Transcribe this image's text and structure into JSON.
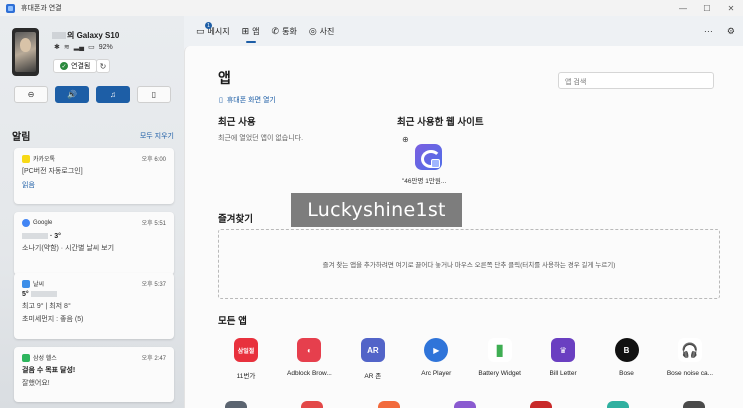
{
  "window": {
    "title": "휴대폰과 연결",
    "controls": [
      "—",
      "☐",
      "✕"
    ]
  },
  "device": {
    "name": "의 Galaxy S10",
    "battery": "92%",
    "connected_label": "연결됨"
  },
  "quick_actions": [
    {
      "icon": "⊖",
      "on": false
    },
    {
      "icon": "🔊",
      "on": true
    },
    {
      "icon": "♫",
      "on": true
    },
    {
      "icon": "▯",
      "on": false
    }
  ],
  "notifications": {
    "title": "알림",
    "clear_all": "모두 지우기",
    "cards": [
      {
        "app": "카카오톡",
        "time": "오후 6:00",
        "lines": [
          "[PC버전 자동로그인]"
        ],
        "link": "읽음",
        "color": "#f7d916"
      },
      {
        "app": "Google",
        "time": "오후 5:51",
        "lines": [
          "· 3°",
          "소나기(약함) · 시간별 날씨 보기"
        ],
        "color": "#4285f4"
      },
      {
        "app": "날씨",
        "time": "오후 5:37",
        "lines": [
          "5°",
          "최고 9° | 최저 8°",
          "초미세먼지 : 좋음 (5)"
        ],
        "color": "#3d8ee8"
      },
      {
        "app": "삼성 헬스",
        "time": "오후 2:47",
        "lines": [
          "걸음 수 목표 달성!",
          "잘했어요!"
        ],
        "color": "#2db55d"
      }
    ]
  },
  "tabs": [
    {
      "label": "메시지",
      "icon": "💬",
      "badge": "1"
    },
    {
      "label": "앱",
      "icon": "⊞",
      "active": true
    },
    {
      "label": "통화",
      "icon": "✆"
    },
    {
      "label": "사진",
      "icon": "◎"
    }
  ],
  "toolbar": {
    "more": "···",
    "settings": "⚙"
  },
  "main": {
    "title": "앱",
    "search_placeholder": "앱 검색",
    "open_phone": "휴대폰 화면 열기",
    "recent_title": "최근 사용",
    "recent_empty": "최근에 열었던 앱이 없습니다.",
    "sites_title": "최근 사용한 웹 사이트",
    "site_label": "\"46만명 1만원...",
    "watermark": "Luckyshine1st",
    "favorites_title": "즐겨찾기",
    "favorites_hint": "즐겨 찾는 앱을 추가하려면 여기로 끌어다 놓거나 마우스 오른쪽 단추 클릭(터치를 사용하는 경우 길게 누르기)",
    "all_apps_title": "모든 앱"
  },
  "apps": [
    {
      "label": "11번가",
      "icon_text": "삼일절",
      "color": "#e8313d"
    },
    {
      "label": "Adblock Brow...",
      "icon_text": "◐",
      "color": "#e63f4d"
    },
    {
      "label": "AR 존",
      "icon_text": "AR",
      "color": "#5264c8"
    },
    {
      "label": "Arc Player",
      "icon_text": "▶",
      "color": "#2f74d9"
    },
    {
      "label": "Battery Widget",
      "icon_text": "▮",
      "color": "#3fae53"
    },
    {
      "label": "Bill Letter",
      "icon_text": "♛",
      "color": "#6a3fc1"
    },
    {
      "label": "Bose",
      "icon_text": "B",
      "color": "#111111"
    },
    {
      "label": "Bose noise ca...",
      "icon_text": "🎧",
      "color": "#ffffff"
    }
  ],
  "apps_row2_colors": [
    "#5b6470",
    "#e34848",
    "#f26a3c",
    "#8a5ad0",
    "#c92a2a",
    "#2fb0a0",
    "#4a4a4a"
  ]
}
